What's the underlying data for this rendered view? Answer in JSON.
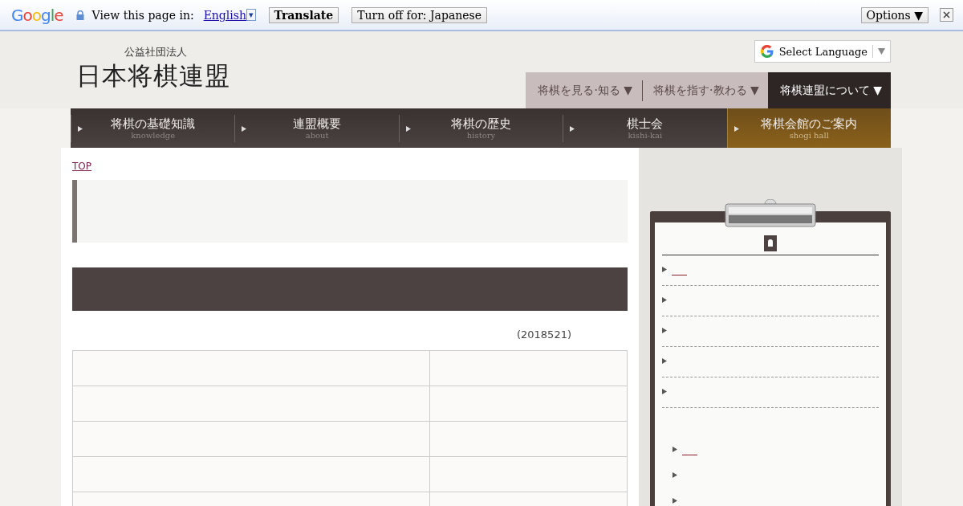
{
  "translate_bar": {
    "logo": "Google",
    "view_label": "View this page in:",
    "language": "English",
    "dropdown_mark": "▾",
    "translate_button": "Translate",
    "turn_off_button": "Turn off for: Japanese",
    "options_button": "Options ▼"
  },
  "header": {
    "org_type": "公益社団法人",
    "org_name": "日本将棋連盟",
    "language_select": "Select Language"
  },
  "top_menu": [
    {
      "label": "将棋を見る·知る ▼",
      "selected": false
    },
    {
      "label": "将棋を指す·教わる ▼",
      "selected": false
    },
    {
      "label": "将棋連盟について ▼",
      "selected": true
    }
  ],
  "sub_menu": [
    {
      "label": "将棋の基礎知識",
      "sublabel": "knowledge",
      "selected": false
    },
    {
      "label": "連盟概要",
      "sublabel": "about",
      "selected": false
    },
    {
      "label": "将棋の歴史",
      "sublabel": "history",
      "selected": false
    },
    {
      "label": "棋士会",
      "sublabel": "kishi-kai",
      "selected": false
    },
    {
      "label": "将棋会館のご案内",
      "sublabel": "shogi hall",
      "selected": true
    }
  ],
  "breadcrumb": "TOP",
  "date": "(2018521)"
}
